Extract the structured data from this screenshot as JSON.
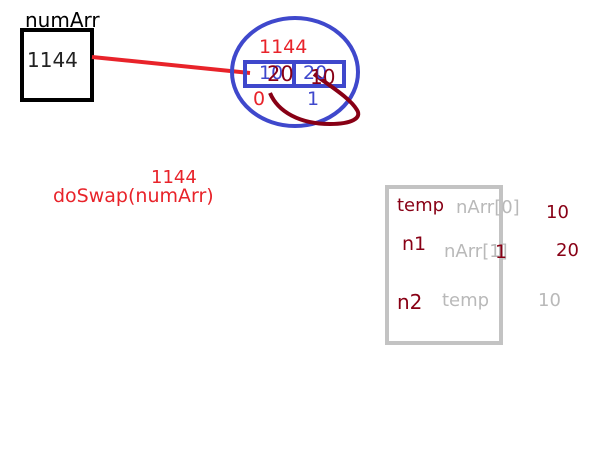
{
  "colors": {
    "black": "#000000",
    "red": "#e8232a",
    "blue": "#3f48cc",
    "maroon": "#880015",
    "gray": "#b9b9b9"
  },
  "variable_box": {
    "name": "numArr",
    "value": "1144"
  },
  "array_circle": {
    "address": "1144",
    "cell0_old": "10",
    "cell0_new": "20",
    "cell1_old": "20",
    "cell1_new": "10",
    "index0": "0",
    "index1": "1"
  },
  "call": {
    "address": "1144",
    "text": "doSwap(numArr)"
  },
  "function_frame": {
    "row1": {
      "name": "temp",
      "param": "nArr[0]",
      "value": "10"
    },
    "row2": {
      "name": "n1",
      "param": "nArr[1]",
      "value": "20",
      "extra": "1"
    },
    "row3": {
      "name": "n2",
      "param": "temp",
      "value": "10"
    }
  }
}
